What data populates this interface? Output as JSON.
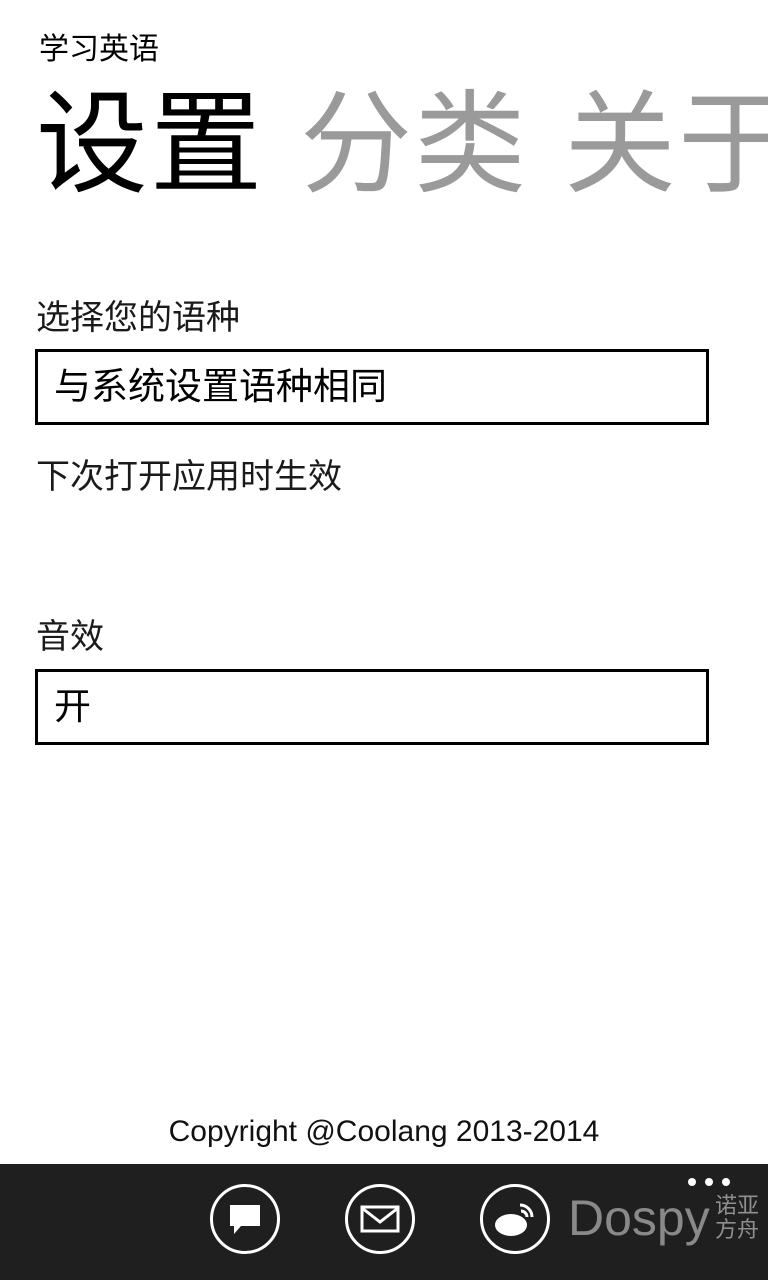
{
  "app": {
    "title": "学习英语"
  },
  "pivot": {
    "tabs": [
      {
        "label": "设置"
      },
      {
        "label": "分类"
      },
      {
        "label": "关于"
      }
    ]
  },
  "settings": {
    "language": {
      "label": "选择您的语种",
      "value": "与系统设置语种相同",
      "hint": "下次打开应用时生效"
    },
    "sound": {
      "label": "音效",
      "value": "开"
    }
  },
  "footer": {
    "copyright": "Copyright @Coolang 2013-2014"
  },
  "appbar": {
    "buttons": [
      {
        "icon": "comment-icon"
      },
      {
        "icon": "mail-icon"
      },
      {
        "icon": "weibo-icon"
      }
    ],
    "more_icon": "ellipsis-icon"
  },
  "watermark": {
    "text": "Dospy",
    "subtitle": "诺亚方舟"
  }
}
